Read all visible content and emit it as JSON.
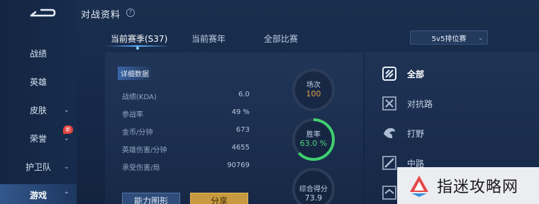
{
  "header": {
    "title": "对战资料",
    "help_glyph": "?"
  },
  "sidebar": {
    "items": [
      {
        "label": "战绩",
        "chevron": ""
      },
      {
        "label": "英雄",
        "chevron": ""
      },
      {
        "label": "皮肤",
        "chevron": "⌄"
      },
      {
        "label": "荣誉",
        "chevron": "⌄",
        "badge": "新"
      },
      {
        "label": "护卫队",
        "chevron": "⌄"
      },
      {
        "label": "游戏",
        "chevron": "⌃"
      }
    ],
    "active_index": 5
  },
  "tabs": [
    {
      "label": "当前赛季(S37)"
    },
    {
      "label": "当前赛年"
    },
    {
      "label": "全部比赛"
    }
  ],
  "mode_select": {
    "value": "5v5排位赛",
    "caret": "⌄"
  },
  "details": {
    "section_label": "详细数据",
    "rows": [
      {
        "label": "战绩(KDA)",
        "value": "6.0"
      },
      {
        "label": "参战率",
        "value": "49 %"
      },
      {
        "label": "金币/分钟",
        "value": "673"
      },
      {
        "label": "英雄伤害/分钟",
        "value": "4655"
      },
      {
        "label": "承受伤害/局",
        "value": "90769"
      }
    ]
  },
  "rings": {
    "matches": {
      "title": "场次",
      "value": "100",
      "value_color": "#e2a34a"
    },
    "winrate": {
      "title": "胜率",
      "value": "63.0 %",
      "value_color": "#4cd37a",
      "fraction": 0.63
    },
    "score": {
      "title": "综合得分",
      "value": "73.9",
      "value_color": "#c7d3e6"
    }
  },
  "buttons": {
    "ability": "能力图形",
    "share": "分享"
  },
  "roles": [
    {
      "label": "全部",
      "icon": "all-roles-icon"
    },
    {
      "label": "对抗路",
      "icon": "clash-lane-icon"
    },
    {
      "label": "打野",
      "icon": "jungle-icon"
    },
    {
      "label": "中路",
      "icon": "mid-lane-icon"
    },
    {
      "label": "",
      "icon": "role-icon"
    }
  ],
  "watermark": {
    "text": "指迷攻略网"
  },
  "colors": {
    "accent": "#5fb0ff",
    "win": "#4cd37a",
    "matches": "#e2a34a",
    "share": "#c79a3f"
  }
}
